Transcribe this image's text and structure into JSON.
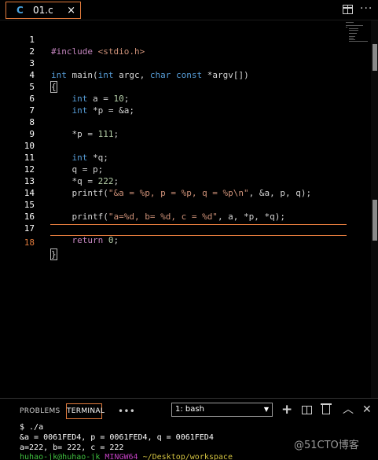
{
  "tab": {
    "icon": "C",
    "filename": "01.c",
    "close": "×"
  },
  "editor": {
    "lines": [
      {
        "n": "1"
      },
      {
        "n": "2"
      },
      {
        "n": "3"
      },
      {
        "n": "4"
      },
      {
        "n": "5"
      },
      {
        "n": "6"
      },
      {
        "n": "7"
      },
      {
        "n": "8"
      },
      {
        "n": "9"
      },
      {
        "n": "10"
      },
      {
        "n": "11"
      },
      {
        "n": "12"
      },
      {
        "n": "13"
      },
      {
        "n": "14"
      },
      {
        "n": "15"
      },
      {
        "n": "16"
      },
      {
        "n": "17"
      },
      {
        "n": "18"
      }
    ],
    "code": {
      "l1_pp": "#include",
      "l1_hdr": "<stdio.h>",
      "l3_int": "int",
      "l3_main": " main(",
      "l3_int2": "int",
      "l3_argc": " argc, ",
      "l3_char": "char",
      "l3_sp": " ",
      "l3_const": "const",
      "l3_rest": " *argv[])",
      "l4_brace": "{",
      "l5_int": "int",
      "l5_rest": " a = ",
      "l5_num": "10",
      "l5_end": ";",
      "l6_int": "int",
      "l6_rest": " *p = &a;",
      "l8_rest": "*p = ",
      "l8_num": "111",
      "l8_end": ";",
      "l10_int": "int",
      "l10_rest": " *q;",
      "l11": "q = p;",
      "l12_rest": "*q = ",
      "l12_num": "222",
      "l12_end": ";",
      "l13_fn": "printf(",
      "l13_str": "\"&a = %p, p = %p, q = %p\\n\"",
      "l13_end": ", &a, p, q);",
      "l15_fn": "printf(",
      "l15_str": "\"a=%d, b= %d, c = %d\"",
      "l15_end": ", a, *p, *q);",
      "l17_ret": "return",
      "l17_num": " 0",
      "l17_end": ";",
      "l18_brace": "}"
    }
  },
  "panel": {
    "tabs": {
      "problems": "PROBLEMS",
      "terminal": "TERMINAL",
      "more": "•••"
    },
    "terminal_select": "1: bash",
    "output": {
      "prompt_line": "$ ./a",
      "out1": "&a = 0061FED4, p = 0061FED4, q = 0061FED4",
      "out2": "a=222, b= 222, c = 222",
      "user": "huhao-jk@huhao-jk",
      "env": "MINGW64",
      "path": "~/Desktop/workspace"
    }
  },
  "watermark": "@51CTO博客",
  "colors": {
    "accent": "#e07a3c",
    "keyword": "#569cd6",
    "string": "#ce9178",
    "number": "#b5cea8",
    "preprocessor": "#c586c0"
  },
  "icons": [
    "split-editor-icon",
    "more-actions-icon",
    "add-terminal-icon",
    "split-terminal-icon",
    "trash-icon",
    "chevron-up-icon",
    "close-icon",
    "dropdown-arrow-icon"
  ]
}
